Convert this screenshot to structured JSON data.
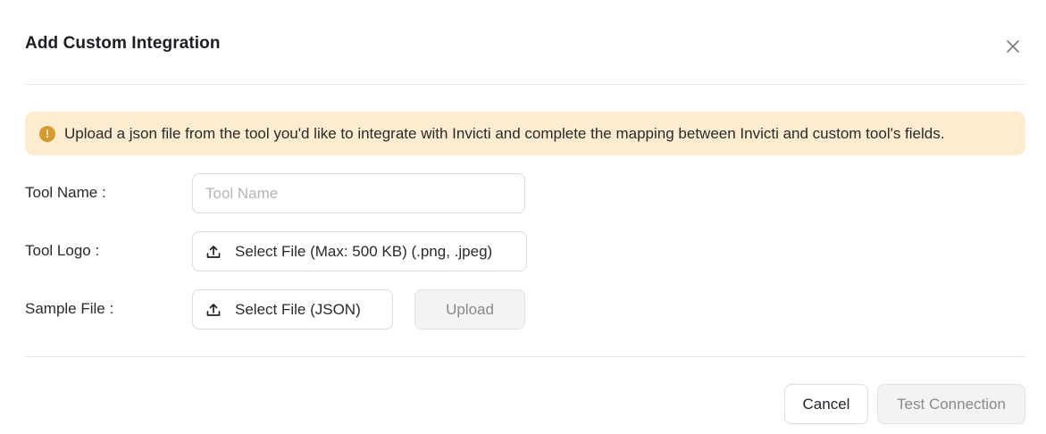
{
  "dialog": {
    "title": "Add Custom Integration",
    "close_icon": "close-icon"
  },
  "alert": {
    "icon": "exclamation-icon",
    "icon_glyph": "!",
    "text": "Upload a json file from the tool you'd like to integrate with Invicti and complete the mapping between Invicti and custom tool's fields.",
    "background_color": "#fdecd0",
    "icon_color": "#d69a2d"
  },
  "form": {
    "tool_name": {
      "label": "Tool Name :",
      "value": "",
      "placeholder": "Tool Name"
    },
    "tool_logo": {
      "label": "Tool Logo :",
      "button_label": "Select File (Max: 500 KB) (.png, .jpeg)",
      "icon": "upload-icon"
    },
    "sample_file": {
      "label": "Sample File :",
      "button_label": "Select File (JSON)",
      "icon": "upload-icon",
      "upload_label": "Upload"
    }
  },
  "footer": {
    "cancel_label": "Cancel",
    "test_connection_label": "Test Connection"
  }
}
